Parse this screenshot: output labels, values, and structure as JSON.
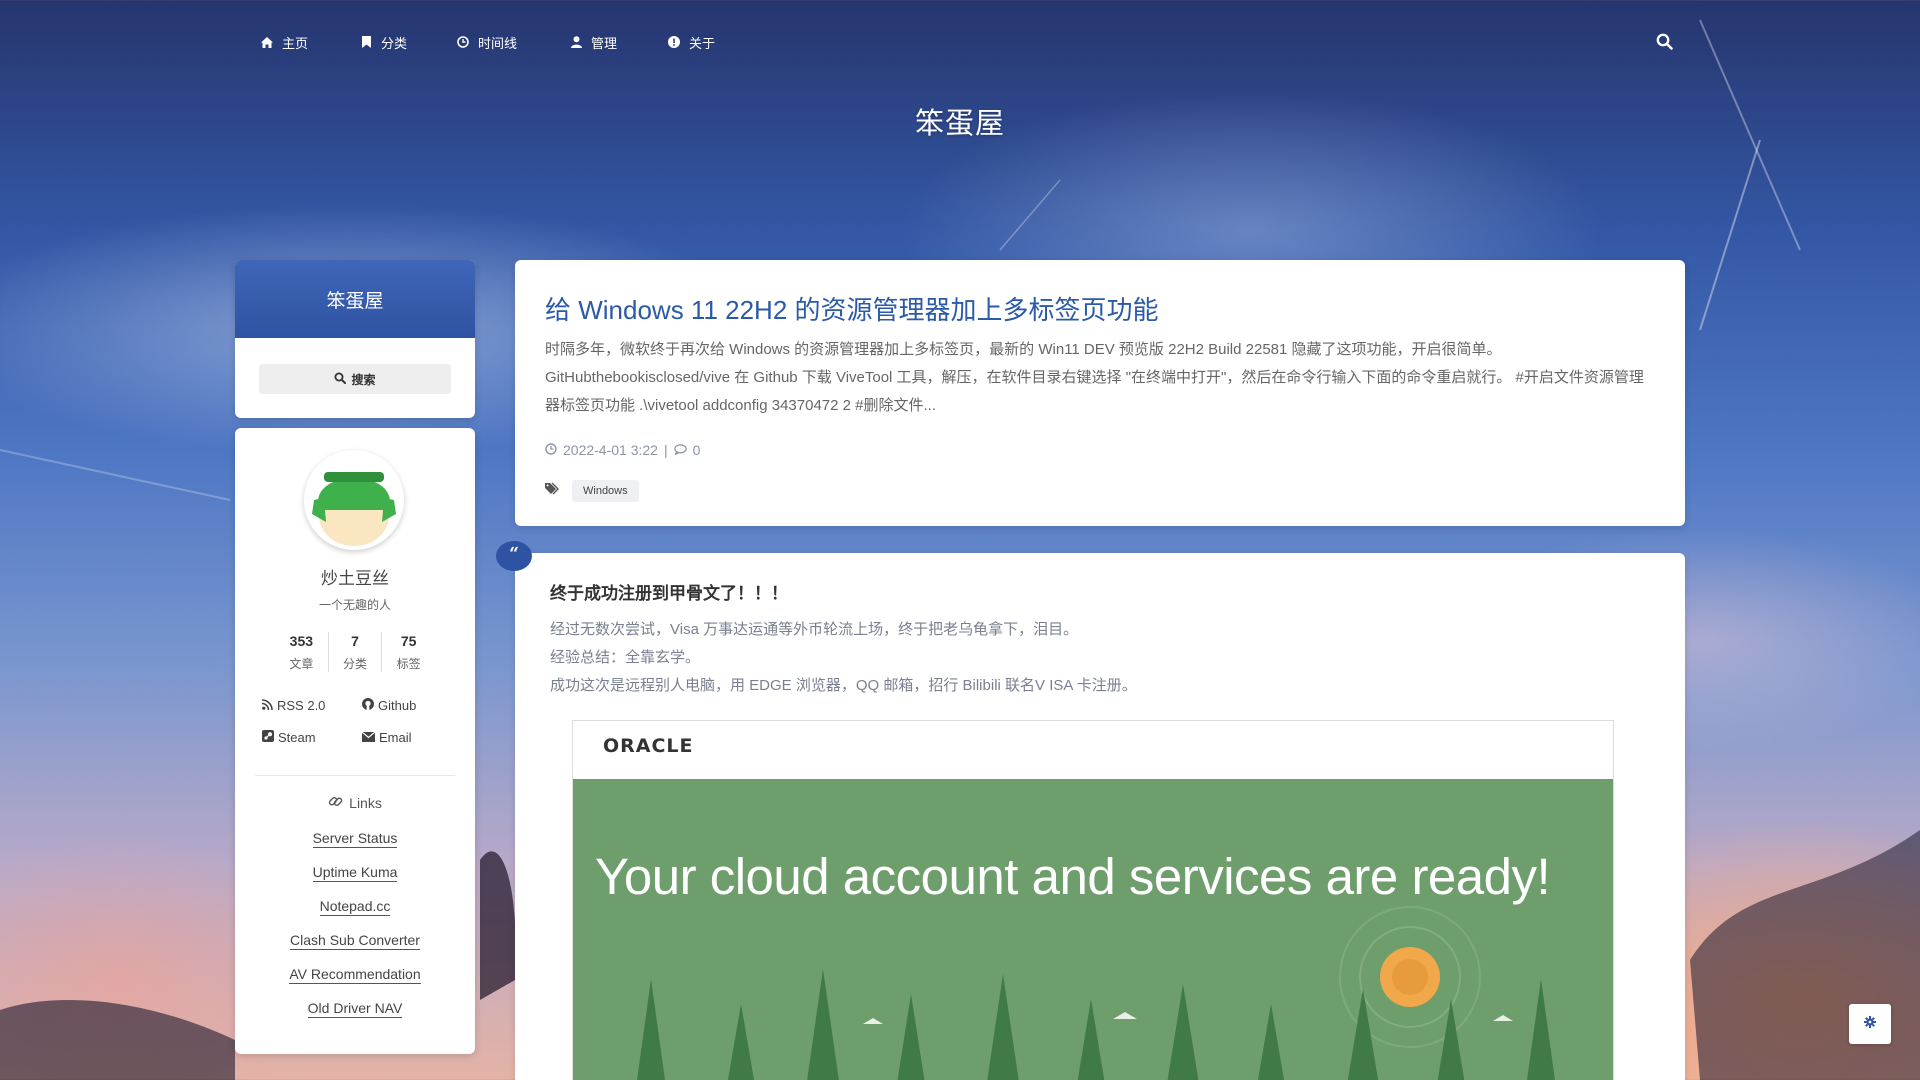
{
  "nav": {
    "items": [
      {
        "label": "主页",
        "icon": "home-icon"
      },
      {
        "label": "分类",
        "icon": "bookmark-icon"
      },
      {
        "label": "时间线",
        "icon": "clock-icon"
      },
      {
        "label": "管理",
        "icon": "user-icon"
      },
      {
        "label": "关于",
        "icon": "info-icon"
      }
    ],
    "search_icon": "search-icon"
  },
  "site": {
    "title": "笨蛋屋"
  },
  "sidebar": {
    "brand": "笨蛋屋",
    "search_label": "搜索",
    "author": {
      "name": "炒土豆丝",
      "desc": "一个无趣的人"
    },
    "stats": [
      {
        "num": "353",
        "label": "文章"
      },
      {
        "num": "7",
        "label": "分类"
      },
      {
        "num": "75",
        "label": "标签"
      }
    ],
    "social": [
      {
        "label": "RSS 2.0",
        "icon": "rss-icon"
      },
      {
        "label": "Github",
        "icon": "github-icon"
      },
      {
        "label": "Steam",
        "icon": "steam-icon"
      },
      {
        "label": "Email",
        "icon": "envelope-icon"
      }
    ],
    "links_title": "Links",
    "links": [
      "Server Status",
      "Uptime Kuma",
      "Notepad.cc",
      "Clash Sub Converter",
      "AV Recommendation",
      "Old Driver NAV"
    ]
  },
  "posts": [
    {
      "title": "给 Windows 11 22H2 的资源管理器加上多标签页功能",
      "excerpt": "时隔多年，微软终于再次给 Windows 的资源管理器加上多标签页，最新的 Win11 DEV 预览版 22H2 Build 22581 隐藏了这项功能，开启很简单。 GitHubthebookisclosed/vive 在 Github 下载 ViveTool 工具，解压，在软件目录右键选择 \"在终端中打开\"，然后在命令行输入下面的命令重启就行。 #开启文件资源管理器标签页功能 .\\vivetool addconfig 34370472 2 #删除文件...",
      "date": "2022-4-01 3:22",
      "comments": "0",
      "tags": [
        "Windows"
      ]
    }
  ],
  "quote_post": {
    "badge": "“",
    "title": "终于成功注册到甲骨文了！！！",
    "lines": [
      "经过无数次尝试，Visa 万事达运通等外币轮流上场，终于把老乌龟拿下，泪目。",
      "经验总结：全靠玄学。",
      "成功这次是远程别人电脑，用 EDGE 浏览器，QQ 邮箱，招行 Bilibili 联名V ISA 卡注册。"
    ],
    "image": {
      "logo": "ORACLE",
      "heading": "Your cloud account and services are ready!"
    }
  },
  "colors": {
    "accent": "#2f53a3",
    "title_link": "#2a5aa8",
    "banner_green": "#6e9e6c"
  }
}
